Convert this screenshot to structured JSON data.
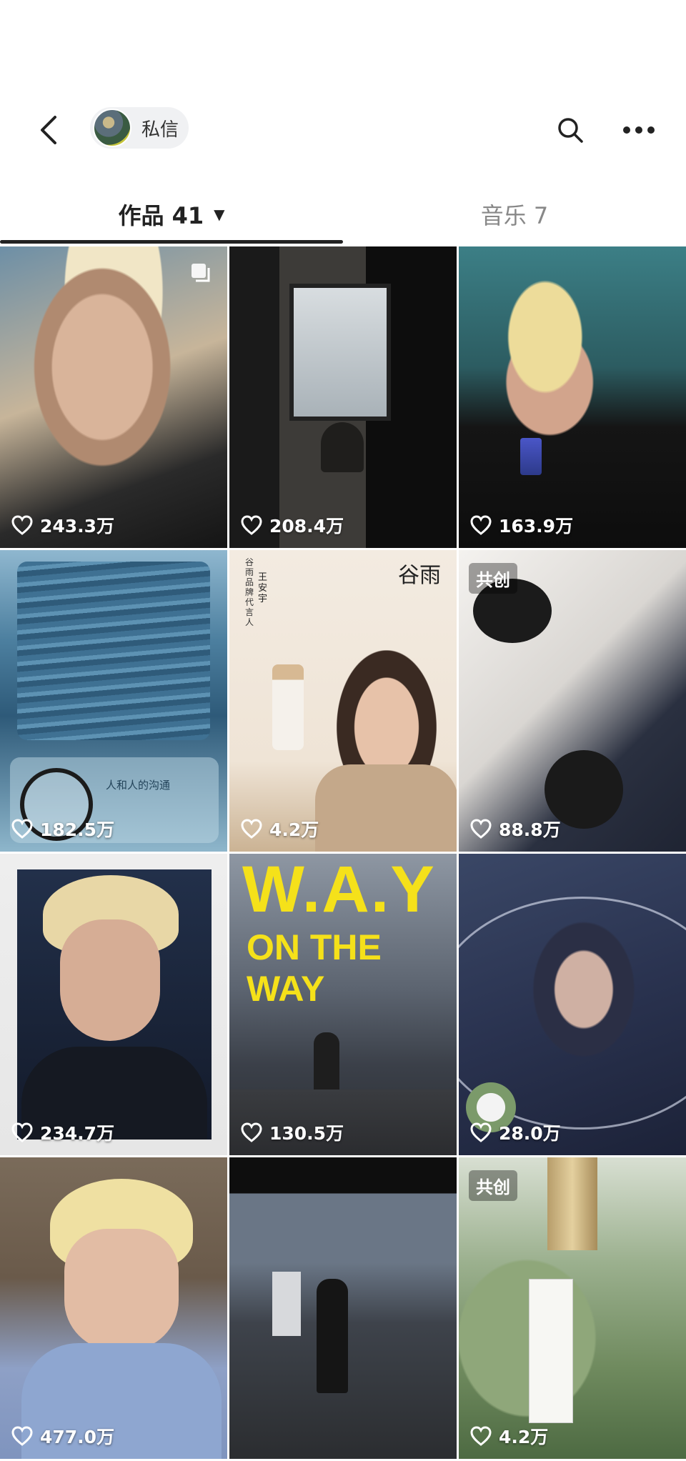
{
  "header": {
    "chat_label": "私信",
    "icons": [
      "back-arrow-icon",
      "search-icon",
      "more-icon"
    ]
  },
  "tabs": {
    "works_label": "作品 41",
    "music_label": "音乐 7"
  },
  "grid": {
    "items": [
      {
        "likes": "243.3万"
      },
      {
        "likes": "208.4万"
      },
      {
        "likes": "163.9万"
      },
      {
        "likes": "182.5万",
        "music_card_title": "人和人的沟通"
      },
      {
        "likes": "4.2万",
        "brand": "谷雨",
        "brand_vertical": "谷雨品牌代言人",
        "brand_name": "王安宇"
      },
      {
        "likes": "88.8万",
        "badge": "共创"
      },
      {
        "likes": "234.7万"
      },
      {
        "likes": "130.5万",
        "title_line1": "W.A.Y",
        "title_line2": "ON THE WAY"
      },
      {
        "likes": "28.0万"
      },
      {
        "likes": "477.0万"
      },
      {
        "likes": ""
      },
      {
        "likes": "4.2万",
        "badge": "共创"
      }
    ]
  },
  "colors": {
    "accent_yellow": "#f5e11a",
    "tab_active": "#222222",
    "tab_inactive": "#888888"
  }
}
